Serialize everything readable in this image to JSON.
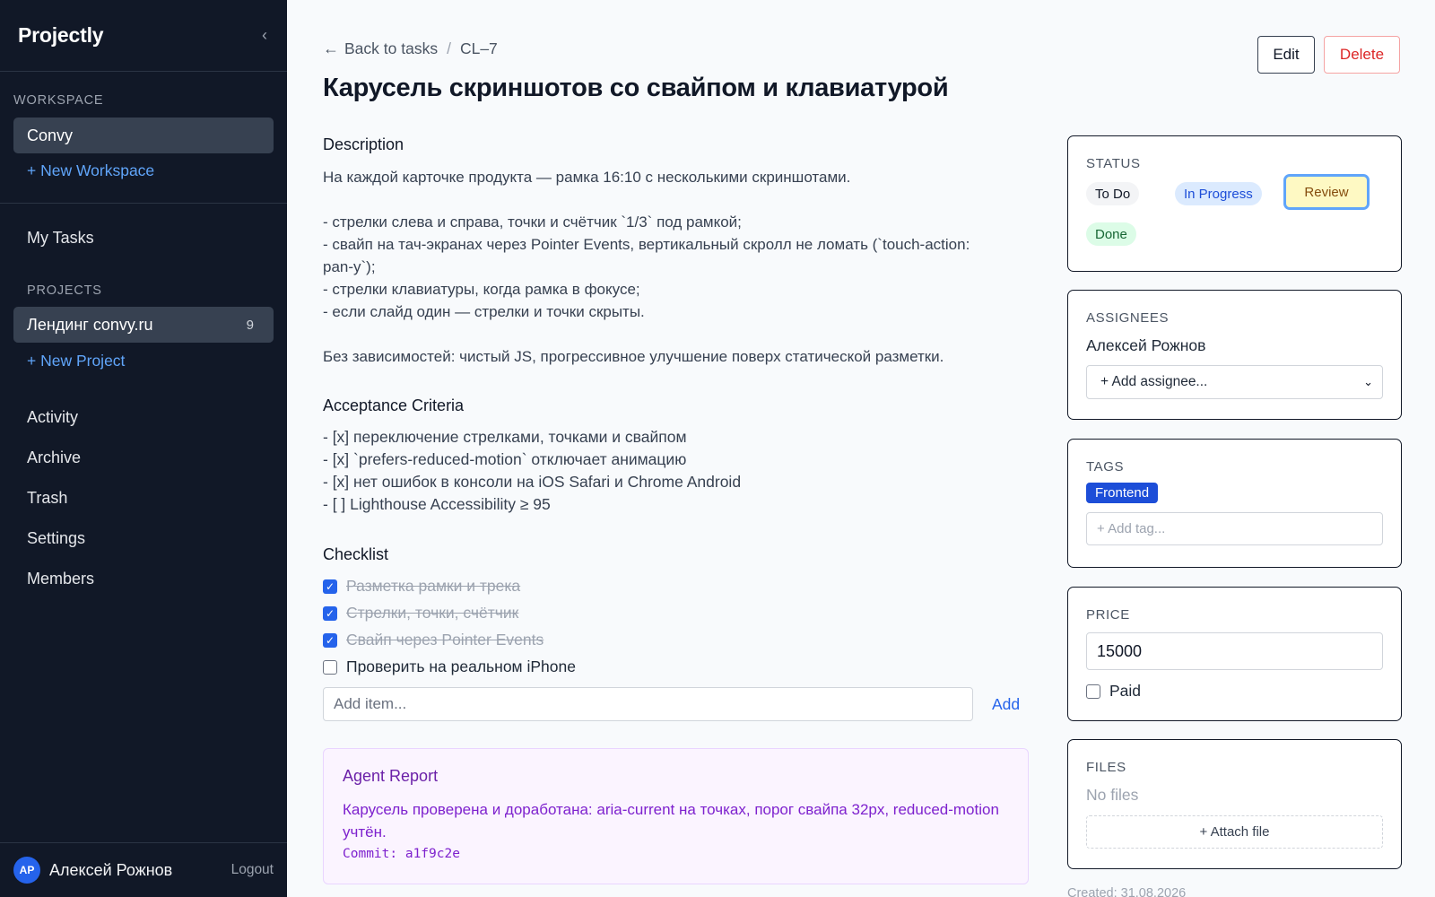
{
  "app": {
    "brand": "Projectly"
  },
  "sidebar": {
    "workspace_label": "WORKSPACE",
    "workspace_current": "Convy",
    "new_workspace": "+ New Workspace",
    "my_tasks": "My Tasks",
    "projects_label": "PROJECTS",
    "project": {
      "name": "Лендинг convy.ru",
      "count": "9"
    },
    "new_project": "+ New Project",
    "nav": [
      "Activity",
      "Archive",
      "Trash",
      "Settings",
      "Members"
    ],
    "user": {
      "initials": "АР",
      "name": "Алексей Рожнов",
      "logout": "Logout"
    }
  },
  "header": {
    "back": "Back to tasks",
    "task_id": "CL–7",
    "title": "Карусель скриншотов со свайпом и клавиатурой",
    "edit": "Edit",
    "delete": "Delete"
  },
  "description": {
    "heading": "Description",
    "text": "На каждой карточке продукта — рамка 16:10 с несколькими скриншотами.\n\n- стрелки слева и справа, точки и счётчик `1/3` под рамкой;\n- свайп на тач-экранах через Pointer Events, вертикальный скролл не ломать (`touch-action:\npan-y`);\n- стрелки клавиатуры, когда рамка в фокусе;\n- если слайд один — стрелки и точки скрыты.\n\nБез зависимостей: чистый JS, прогрессивное улучшение поверх статической разметки."
  },
  "criteria": {
    "heading": "Acceptance Criteria",
    "text": "- [x] переключение стрелками, точками и свайпом\n- [x] `prefers-reduced-motion` отключает анимацию\n- [x] нет ошибок в консоли на iOS Safari и Chrome Android\n- [ ] Lighthouse Accessibility ≥ 95"
  },
  "checklist": {
    "heading": "Checklist",
    "items": [
      {
        "label": "Разметка рамки и трека",
        "done": true
      },
      {
        "label": "Стрелки, точки, счётчик",
        "done": true
      },
      {
        "label": "Свайп через Pointer Events",
        "done": true
      },
      {
        "label": "Проверить на реальном iPhone",
        "done": false
      }
    ],
    "add_placeholder": "Add item...",
    "add_label": "Add"
  },
  "report": {
    "title": "Agent Report",
    "body": "Карусель проверена и доработана: aria-current на точках, порог свайпа 32px, reduced-motion учтён.",
    "commit": "Commit: a1f9c2e"
  },
  "status": {
    "label": "STATUS",
    "options": [
      "To Do",
      "In Progress",
      "Review",
      "Done"
    ],
    "selected": "Review"
  },
  "assignees": {
    "label": "ASSIGNEES",
    "current": "Алексей Рожнов",
    "add": "+ Add assignee..."
  },
  "tags": {
    "label": "TAGS",
    "items": [
      "Frontend"
    ],
    "add_placeholder": "+ Add tag..."
  },
  "price": {
    "label": "PRICE",
    "value": "15000",
    "paid_label": "Paid",
    "paid": false
  },
  "files": {
    "label": "FILES",
    "empty": "No files",
    "attach": "+ Attach file"
  },
  "meta": {
    "created": "Created: 31.08.2026"
  },
  "colors": {
    "sidebar_bg": "#111827",
    "accent": "#2563eb",
    "danger": "#dc2626"
  }
}
